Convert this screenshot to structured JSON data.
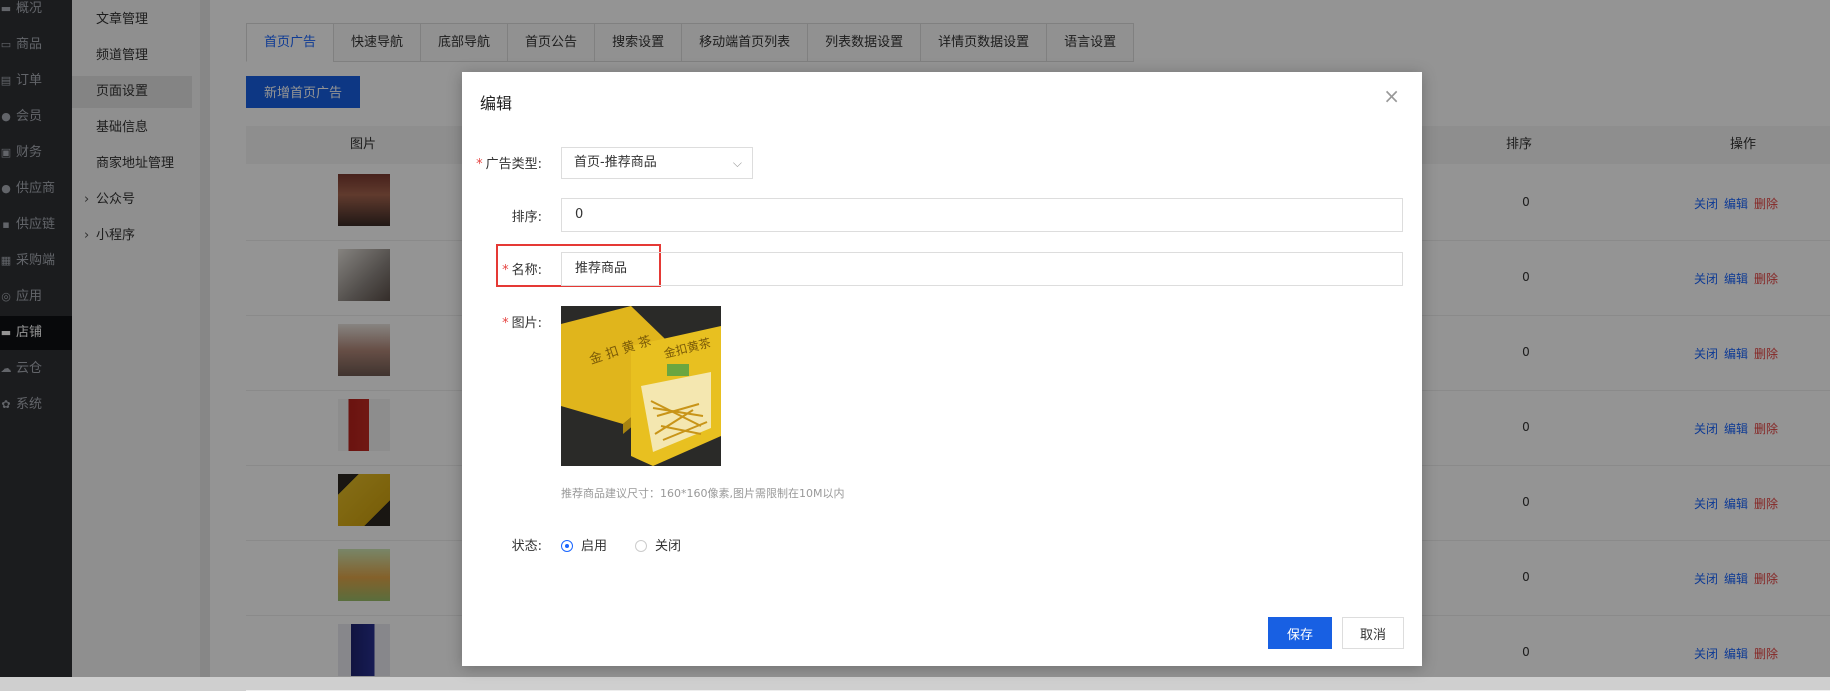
{
  "sidebar_primary": {
    "items": [
      {
        "label": "概况",
        "icon": "dashboard-icon"
      },
      {
        "label": "商品",
        "icon": "goods-icon"
      },
      {
        "label": "订单",
        "icon": "order-icon"
      },
      {
        "label": "会员",
        "icon": "member-icon"
      },
      {
        "label": "财务",
        "icon": "finance-icon"
      },
      {
        "label": "供应商",
        "icon": "supplier-icon"
      },
      {
        "label": "供应链",
        "icon": "supply-chain-icon"
      },
      {
        "label": "采购端",
        "icon": "purchase-icon"
      },
      {
        "label": "应用",
        "icon": "apps-icon"
      },
      {
        "label": "店铺",
        "icon": "store-icon",
        "active": true
      },
      {
        "label": "云仓",
        "icon": "cloud-warehouse-icon"
      },
      {
        "label": "系统",
        "icon": "system-gear-icon"
      }
    ]
  },
  "sidebar_secondary": {
    "items": [
      {
        "label": "文章管理"
      },
      {
        "label": "频道管理"
      },
      {
        "label": "页面设置",
        "active": true
      },
      {
        "label": "基础信息"
      },
      {
        "label": "商家地址管理"
      },
      {
        "label": "公众号",
        "group": true
      },
      {
        "label": "小程序",
        "group": true
      }
    ]
  },
  "tabs": [
    {
      "label": "首页广告",
      "active": true
    },
    {
      "label": "快速导航"
    },
    {
      "label": "底部导航"
    },
    {
      "label": "首页公告"
    },
    {
      "label": "搜索设置"
    },
    {
      "label": "移动端首页列表"
    },
    {
      "label": "列表数据设置"
    },
    {
      "label": "详情页数据设置"
    },
    {
      "label": "语言设置"
    }
  ],
  "add_button": "新增首页广告",
  "table": {
    "headers": {
      "image": "图片",
      "rank": "排序",
      "ops": "操作"
    },
    "rows": [
      {
        "rank": "0"
      },
      {
        "rank": "0"
      },
      {
        "rank": "0"
      },
      {
        "rank": "0"
      },
      {
        "rank": "0"
      },
      {
        "rank": "0"
      },
      {
        "rank": "0"
      }
    ],
    "op_labels": {
      "close": "关闭",
      "edit": "编辑",
      "delete": "删除"
    }
  },
  "modal": {
    "title": "编辑",
    "close_icon": "×",
    "fields": {
      "type_label": "广告类型:",
      "type_value": "首页-推荐商品",
      "rank_label": "排序:",
      "rank_value": "0",
      "name_label": "名称:",
      "name_value": "推荐商品",
      "image_label": "图片:",
      "image_hint": "推荐商品建议尺寸：160*160像素,图片需限制在10M以内",
      "status_label": "状态:",
      "status_on": "启用",
      "status_off": "关闭",
      "status_selected": "启用"
    },
    "save": "保存",
    "cancel": "取消"
  },
  "colors": {
    "primary": "#1860e3",
    "danger": "#e64340",
    "highlight": "#e53935"
  }
}
